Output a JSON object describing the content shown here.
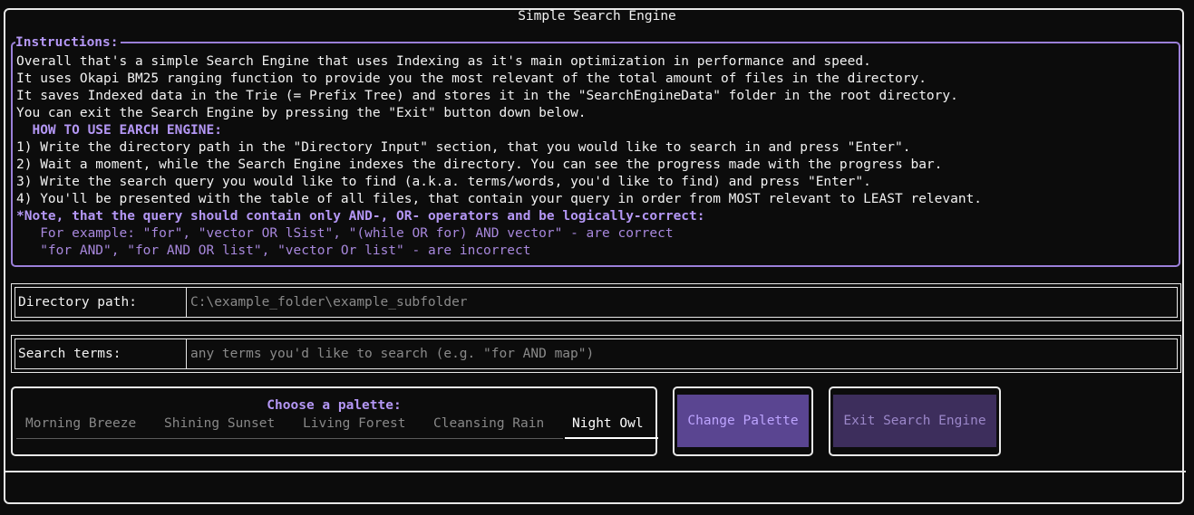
{
  "app": {
    "title": "Simple Search Engine"
  },
  "instructions": {
    "legend": "Instructions:",
    "intro": [
      "Overall that's a simple Search Engine that uses Indexing as it's main optimization in performance and speed.",
      "It uses Okapi BM25 ranging function to provide you the most relevant of the total amount of files in the directory.",
      "It saves Indexed data in the Trie (= Prefix Tree) and stores it in the \"SearchEngineData\" folder in the root directory.",
      "You can exit the Search Engine by pressing the \"Exit\" button down below."
    ],
    "howto_heading": "  HOW TO USE EARCH ENGINE:",
    "steps": [
      "1) Write the directory path in the \"Directory Input\" section, that you would like to search in and press \"Enter\".",
      "2) Wait a moment, while the Search Engine indexes the directory. You can see the progress made with the progress bar.",
      "3) Write the search query you would like to find (a.k.a. terms/words, you'd like to find) and press \"Enter\".",
      "4) You'll be presented with the table of all files, that contain your query in order from MOST relevant to LEAST relevant."
    ],
    "note": "*Note, that the query should contain only AND-, OR- operators and be logically-correct:",
    "example_correct": "   For example: \"for\", \"vector OR lSist\", \"(while OR for) AND vector\" - are correct",
    "example_incorrect": "   \"for AND\", \"for AND OR list\", \"vector Or list\" - are incorrect"
  },
  "directory": {
    "label": "Directory path:",
    "placeholder": "C:\\example_folder\\example_subfolder",
    "value": ""
  },
  "search": {
    "label": "Search terms:",
    "placeholder": "any terms you'd like to search (e.g. \"for AND map\")",
    "value": ""
  },
  "palette": {
    "title": "Choose a palette:",
    "options": [
      "Morning Breeze",
      "Shining Sunset",
      "Living Forest",
      "Cleansing Rain",
      "Night Owl"
    ],
    "selected": "Night Owl"
  },
  "buttons": {
    "change_palette": "Change Palette",
    "exit": "Exit Search Engine"
  },
  "colors": {
    "accent": "#b497f5",
    "border": "#e8e8e8",
    "background": "#0c0c0c",
    "button_primary": "#5a4591",
    "button_secondary": "#3d2e5c"
  }
}
